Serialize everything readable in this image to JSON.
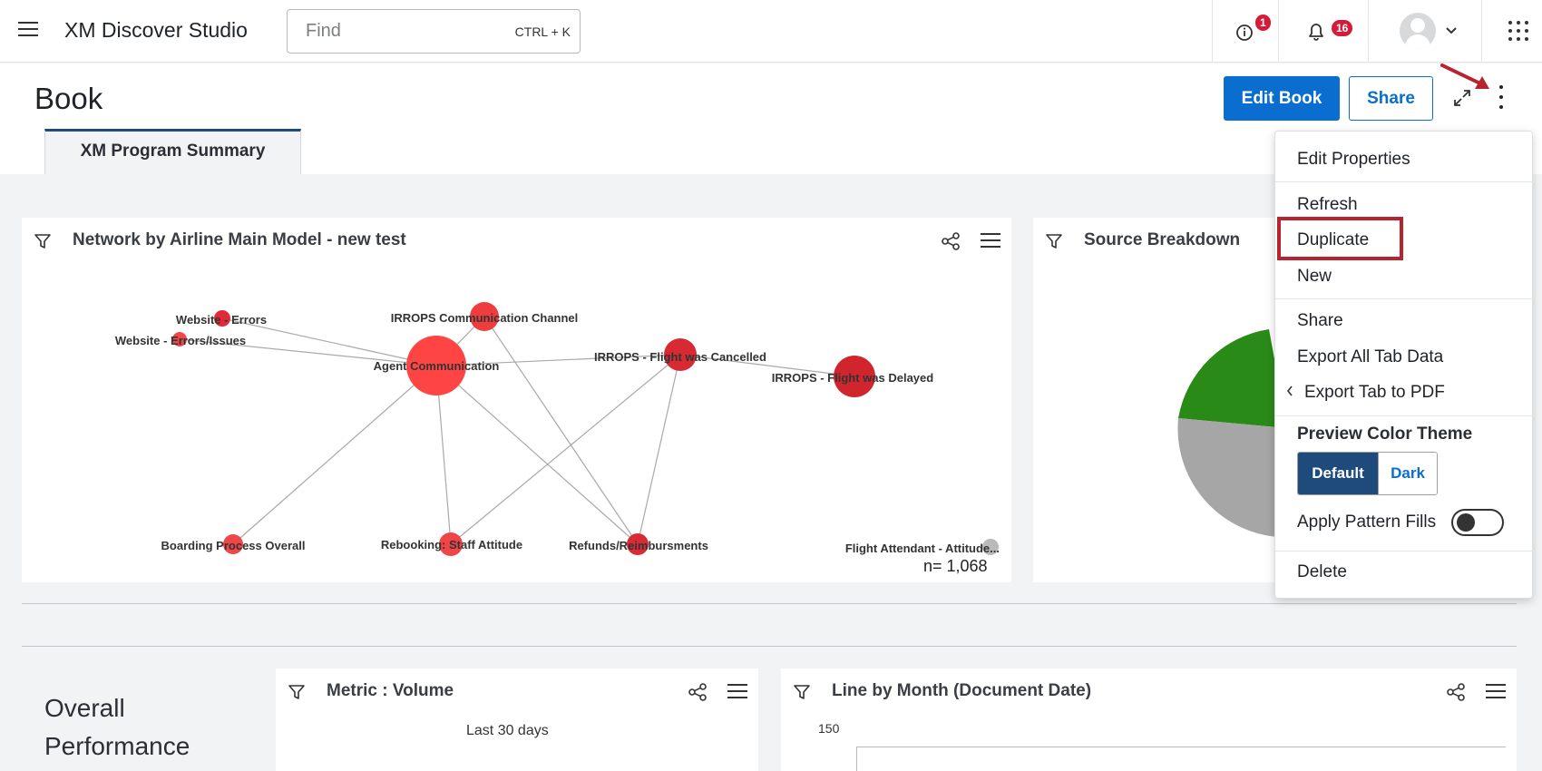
{
  "app": {
    "title": "XM Discover Studio"
  },
  "search": {
    "placeholder": "Find",
    "shortcut": "CTRL + K"
  },
  "header": {
    "info_badge": "1",
    "notification_badge": "16"
  },
  "book": {
    "title": "Book",
    "edit_label": "Edit Book",
    "share_label": "Share",
    "tabs": [
      {
        "label": "XM Program Summary"
      }
    ]
  },
  "widgets": {
    "network": {
      "title": "Network by Airline Main Model - new test",
      "count": "n= 1,068",
      "nodes": [
        {
          "id": "agent",
          "label": "Agent Communication",
          "size": "large",
          "color": "#ff4444"
        },
        {
          "id": "irrops_channel",
          "label": "IRROPS Communication Channel",
          "size": "small",
          "color": "#ee3d3f"
        },
        {
          "id": "web_errors",
          "label": "Website - Errors",
          "size": "tiny",
          "color": "#e02a35"
        },
        {
          "id": "web_issues",
          "label": "Website - Errors/Issues",
          "size": "tiny",
          "color": "#f24748"
        },
        {
          "id": "cancelled",
          "label": "IRROPS - Flight was Cancelled",
          "size": "small",
          "color": "#d72a32"
        },
        {
          "id": "delayed",
          "label": "IRROPS - Flight was Delayed",
          "size": "medium",
          "color": "#d1252e"
        },
        {
          "id": "boarding",
          "label": "Boarding Process Overall",
          "size": "tiny",
          "color": "#f04648"
        },
        {
          "id": "rebooking",
          "label": "Rebooking: Staff Attitude",
          "size": "small",
          "color": "#f04446"
        },
        {
          "id": "refunds",
          "label": "Refunds/Reimbursments",
          "size": "tiny",
          "color": "#d92b35"
        },
        {
          "id": "attendant",
          "label": "Flight Attendant - Attitude...",
          "size": "tiny",
          "color": "#b9b9b9"
        }
      ]
    },
    "source": {
      "title": "Source Breakdown",
      "colors": [
        "#2a8a17",
        "#a6a6a6",
        "#e0e0e0"
      ]
    },
    "metric": {
      "title": "Metric : Volume",
      "subtitle": "Last 30 days"
    },
    "line": {
      "title": "Line by Month (Document Date)",
      "y_tick": "150"
    },
    "section": {
      "title": "Overall Performance"
    }
  },
  "menu": {
    "items": {
      "edit_properties": "Edit Properties",
      "refresh": "Refresh",
      "duplicate": "Duplicate",
      "new": "New",
      "share": "Share",
      "export_all": "Export All Tab Data",
      "export_pdf": "Export Tab to PDF",
      "delete": "Delete"
    },
    "theme": {
      "label": "Preview Color Theme",
      "default": "Default",
      "dark": "Dark",
      "selected": "Default"
    },
    "pattern": {
      "label": "Apply Pattern Fills",
      "enabled": false
    }
  },
  "colors": {
    "accent": "#0a6ed1",
    "highlight": "#b8242e",
    "badge": "#d41b3a",
    "theme_selected": "#1f4a7c"
  }
}
